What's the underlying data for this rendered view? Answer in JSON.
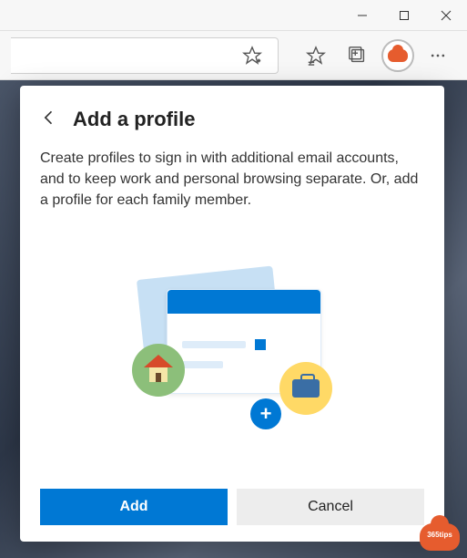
{
  "window": {
    "minimize": "—",
    "maximize": "❐",
    "close": "✕"
  },
  "toolbar": {
    "fav_add_icon": "star-plus-icon",
    "fav_list_icon": "star-list-icon",
    "collections_icon": "collections-icon",
    "profile_icon": "profile-avatar",
    "more_icon": "more-icon"
  },
  "popup": {
    "title": "Add a profile",
    "description": "Create profiles to sign in with additional email accounts, and to keep work and personal browsing separate. Or, add a profile for each family member.",
    "add_label": "Add",
    "cancel_label": "Cancel",
    "plus_glyph": "+"
  },
  "badge": {
    "text": "365tips"
  }
}
